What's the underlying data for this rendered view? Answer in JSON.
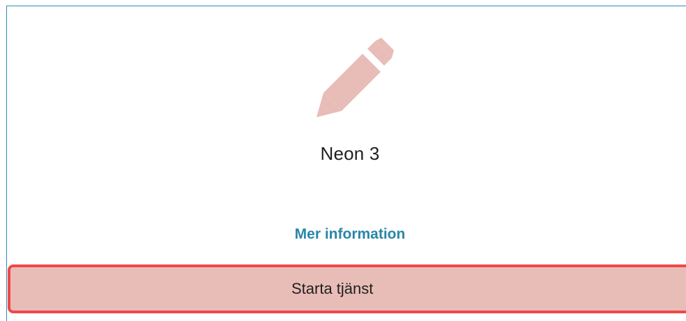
{
  "card": {
    "icon": "pencil-icon",
    "title": "Neon 3",
    "more_info_label": "Mer information",
    "start_button_label": "Starta tjänst"
  },
  "colors": {
    "icon": "#e8bdb7",
    "card_border": "#2a8fb0",
    "link": "#2a86a8",
    "button_fill": "#e8bdb7",
    "button_border": "#f0484a",
    "text": "#1f1f1f"
  }
}
